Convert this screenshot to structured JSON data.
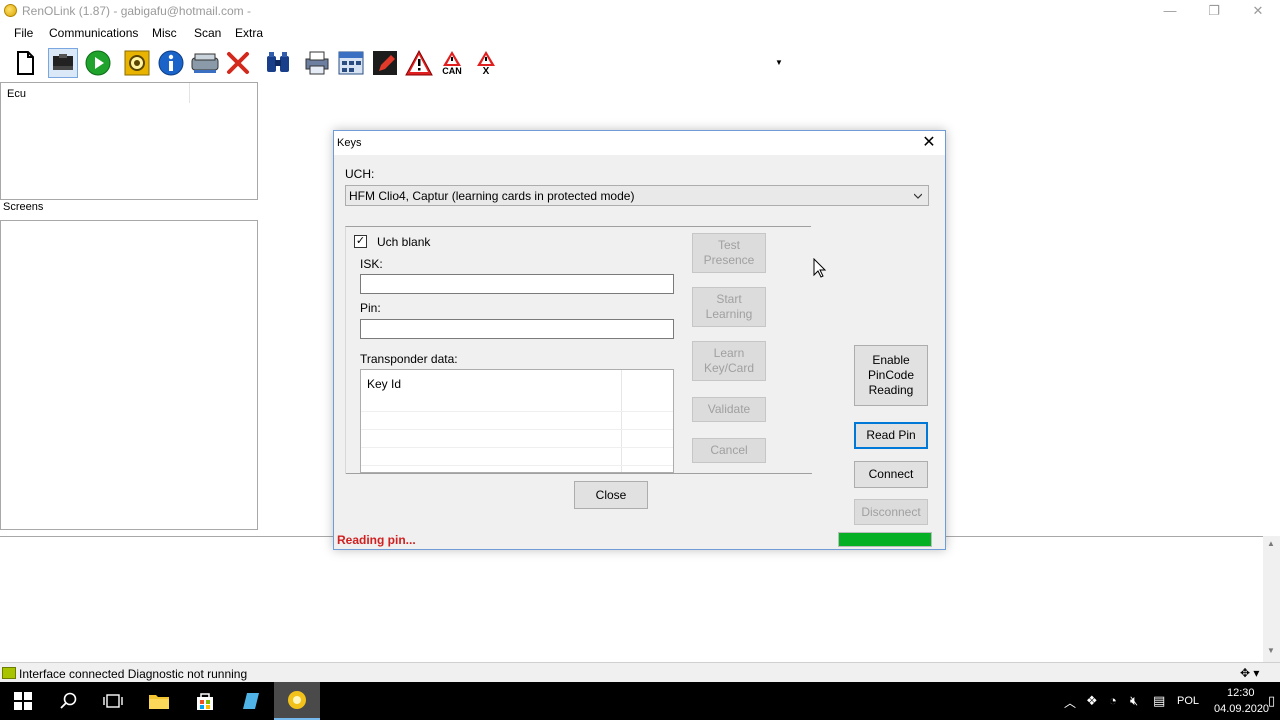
{
  "window": {
    "title": "RenOLink (1.87) - gabigafu@hotmail.com -",
    "minimize_glyph": "—",
    "restore_glyph": "❐",
    "close_glyph": "✕"
  },
  "menu": [
    {
      "label": "File"
    },
    {
      "label": "Communications"
    },
    {
      "label": "Misc"
    },
    {
      "label": "Scan"
    },
    {
      "label": "Extra"
    }
  ],
  "toolbar": {
    "icons": [
      "new-document-icon",
      "interface-icon",
      "play-icon",
      "settings-icon",
      "info-icon",
      "scanner-icon",
      "stop-icon",
      "binoculars-icon",
      "printer-icon",
      "calculator-icon",
      "pen-icon",
      "warning-icon",
      "can-warning-icon",
      "clear-warning-icon"
    ],
    "can_label": "CAN",
    "clear_label": "X"
  },
  "left": {
    "ecu_label": "Ecu",
    "screens_label": "Screens"
  },
  "status": {
    "text": "Interface connected Diagnostic not running",
    "led_color": "#a8c400"
  },
  "dialog": {
    "title": "Keys",
    "uch_label": "UCH:",
    "uch_value": "HFM Clio4, Captur (learning cards in protected mode)",
    "uch_blank_label": "Uch blank",
    "uch_blank_checked": true,
    "isk_label": "ISK:",
    "isk_value": "",
    "pin_label": "Pin:",
    "pin_value": "",
    "transponder_label": "Transponder data:",
    "list_header": "Key Id",
    "buttons": {
      "test_presence": "Test\nPresence",
      "start_learning": "Start\nLearning",
      "learn_key": "Learn\nKey/Card",
      "validate": "Validate",
      "cancel": "Cancel",
      "enable_pincode": "Enable\nPinCode\nReading",
      "read_pin": "Read Pin",
      "connect": "Connect",
      "disconnect": "Disconnect",
      "close": "Close"
    },
    "status_text": "Reading pin...",
    "progress_percent": 100,
    "progress_color": "#06b025"
  },
  "tray": {
    "language": "POL",
    "time": "12:30",
    "date": "04.09.2020"
  }
}
